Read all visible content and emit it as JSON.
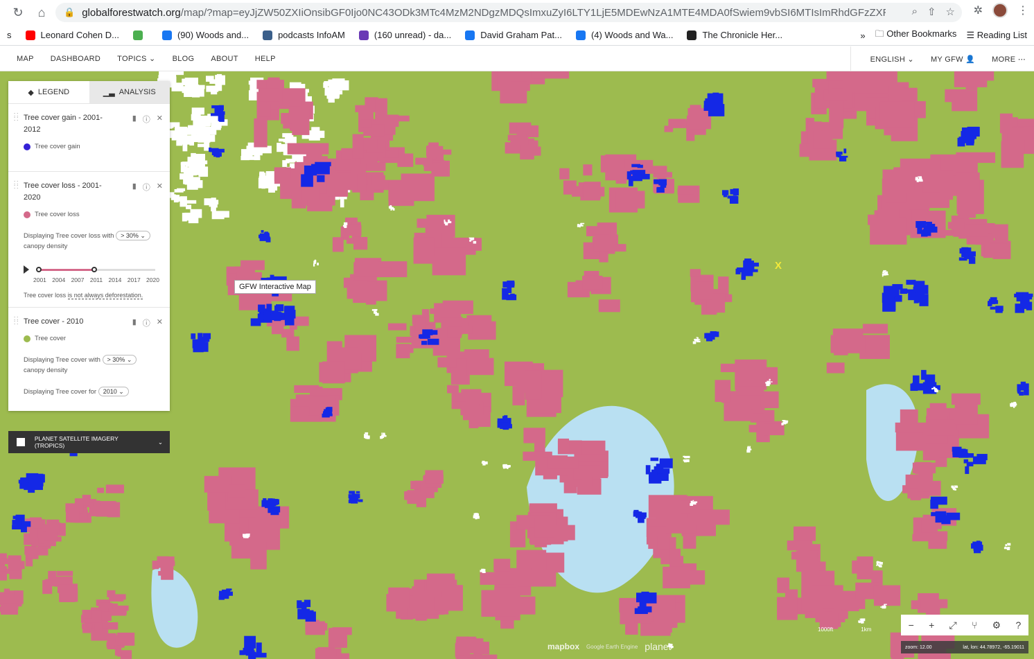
{
  "browser": {
    "url_host": "globalforestwatch.org",
    "url_path": "/map/?map=eyJjZW50ZXIiOnsibGF0Ijo0NC43ODk3MTc4MzM2NDgzMDQsImxuZyI6LTY1LjE5MDEwNzA1MTE4MDA0fSwiem9vbSI6MTIsImRhdGFzZXRzIjpbe...",
    "bookmarks": [
      {
        "label": "s",
        "color": "#ffffff"
      },
      {
        "label": "Leonard Cohen D...",
        "color": "#ff0000"
      },
      {
        "label": "",
        "color": "#4caf50"
      },
      {
        "label": "(90) Woods and...",
        "color": "#1877f2"
      },
      {
        "label": "podcasts InfoAM",
        "color": "#3b5f8a"
      },
      {
        "label": "(160 unread) - da...",
        "color": "#6a3ab5"
      },
      {
        "label": "David Graham Pat...",
        "color": "#1877f2"
      },
      {
        "label": "(4) Woods and Wa...",
        "color": "#1877f2"
      },
      {
        "label": "The Chronicle Her...",
        "color": "#222222"
      }
    ],
    "bookmarks_more": "»",
    "other_bookmarks": "Other Bookmarks",
    "reading_list": "Reading List"
  },
  "gfw_nav": {
    "left": [
      "MAP",
      "DASHBOARD",
      "TOPICS",
      "BLOG",
      "ABOUT",
      "HELP"
    ],
    "right": [
      "ENGLISH",
      "MY GFW",
      "MORE"
    ]
  },
  "panel": {
    "tabs": {
      "legend": "LEGEND",
      "analysis": "ANALYSIS"
    },
    "layers": [
      {
        "title": "Tree cover gain - 2001-2012",
        "legend": "Tree cover gain",
        "color": "#3421d6"
      },
      {
        "title": "Tree cover loss - 2001-2020",
        "legend": "Tree cover loss",
        "color": "#d4698a",
        "density_text": "Displaying Tree cover loss with",
        "density_value": "> 30%",
        "density_suffix": "canopy density",
        "years": [
          "2001",
          "2004",
          "2007",
          "2011",
          "2014",
          "2017",
          "2020"
        ],
        "note_prefix": "Tree cover loss ",
        "note_link": "is not always deforestation."
      },
      {
        "title": "Tree cover - 2010",
        "legend": "Tree cover",
        "color": "#9dbb4f",
        "density_text": "Displaying Tree cover with",
        "density_value": "> 30%",
        "density_suffix": "canopy density",
        "year_text": "Displaying Tree cover for",
        "year_value": "2010"
      }
    ],
    "planet_label": "PLANET SATELLITE IMAGERY (TROPICS)"
  },
  "map": {
    "tooltip": "GFW Interactive Map",
    "marker": "X",
    "zoom": "zoom: 12.00",
    "latlon": "lat, lon: 44.78972, -65.19011",
    "scale_left": "1000ft",
    "scale_right": "1km",
    "attrib_mapbox": "mapbox",
    "attrib_planet": "planet",
    "attrib_text": "Google Earth Engine"
  }
}
